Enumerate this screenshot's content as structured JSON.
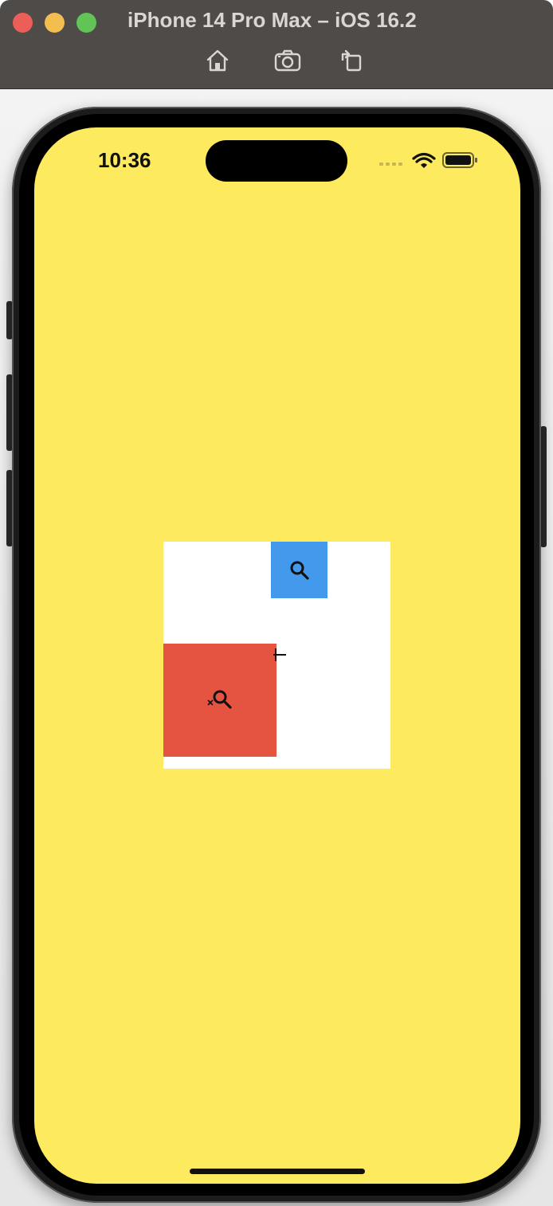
{
  "window": {
    "title": "iPhone 14 Pro Max – iOS 16.2",
    "toolbar": {
      "home_icon": "home-icon",
      "screenshot_icon": "camera-icon",
      "rotate_icon": "rotate-icon"
    },
    "colors": {
      "titlebar": "#4f4b49",
      "close": "#ec5f58",
      "minimize": "#f4bd4f",
      "maximize": "#61c454"
    }
  },
  "status_bar": {
    "time": "10:36",
    "icons": [
      "wifi-icon",
      "battery-icon"
    ]
  },
  "app": {
    "background_color": "#feea5f",
    "stage_color": "#ffffff",
    "blue_box": {
      "color": "#4399ec",
      "icon": "zoom-in-icon"
    },
    "red_box": {
      "color": "#e55441",
      "icon": "zoom-out-icon"
    },
    "cursor": "crosshair-icon"
  }
}
